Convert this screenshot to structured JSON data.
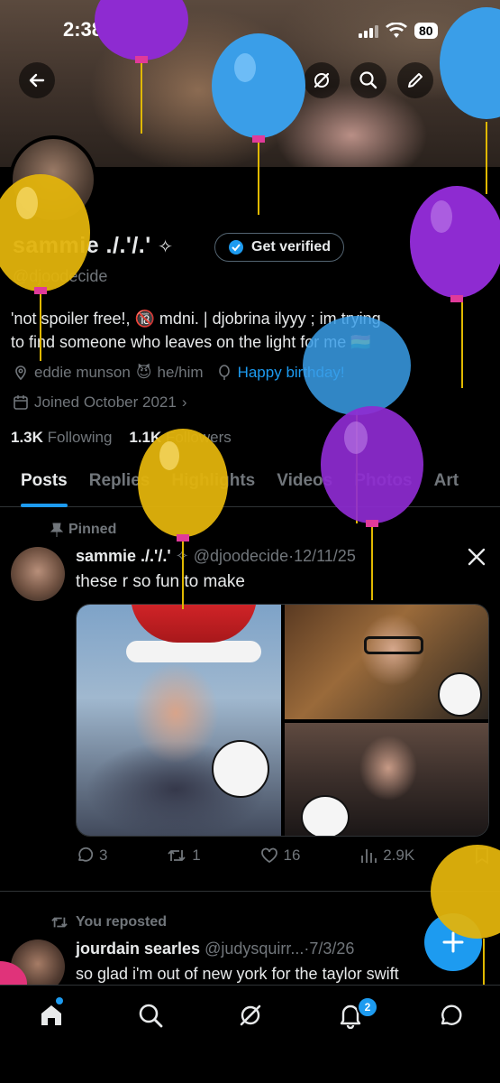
{
  "status_bar": {
    "time": "2:38",
    "battery": "80"
  },
  "profile": {
    "name": "sammie ./.'/.'",
    "handle": "@djoodecide",
    "verify_label": "Get verified",
    "bio_line1": "'not spoiler free!,  🔞 mdni. | djobrina ilyyy ; im trying",
    "bio_line2": "to find someone who leaves on the light for me 🇧🇴",
    "location": "eddie munson",
    "location_emoji": "😈",
    "pronouns": "he/him",
    "birthday": "Happy birthday!",
    "joined": "Joined October 2021",
    "following_count": "1.3K",
    "following_label": "Following",
    "followers_count": "1.1K",
    "followers_label": "Followers"
  },
  "tabs": [
    "Posts",
    "Replies",
    "Highlights",
    "Videos",
    "Photos",
    "Art"
  ],
  "pinned_tweet": {
    "pinned_label": "Pinned",
    "name": "sammie ./.'/.'",
    "handle": "@djoodecide",
    "date": "12/11/25",
    "text": "these r so fun to make",
    "replies": "3",
    "reposts": "1",
    "likes": "16",
    "views": "2.9K"
  },
  "repost_tweet": {
    "repost_label": "You reposted",
    "name": "jourdain searles",
    "handle": "@judysquirr...",
    "date": "7/3/26",
    "text": "so glad i'm out of new york for the taylor swift"
  },
  "nav": {
    "notifications_badge": "2"
  },
  "colors": {
    "accent": "#1d9bf0",
    "background": "#000000",
    "muted": "#71767b",
    "text": "#e7e9ea"
  },
  "icons": [
    "back-arrow-icon",
    "grok-icon",
    "search-icon",
    "edit-icon",
    "share-icon",
    "home-icon",
    "notification-icon",
    "messages-icon",
    "x-logo-icon"
  ]
}
